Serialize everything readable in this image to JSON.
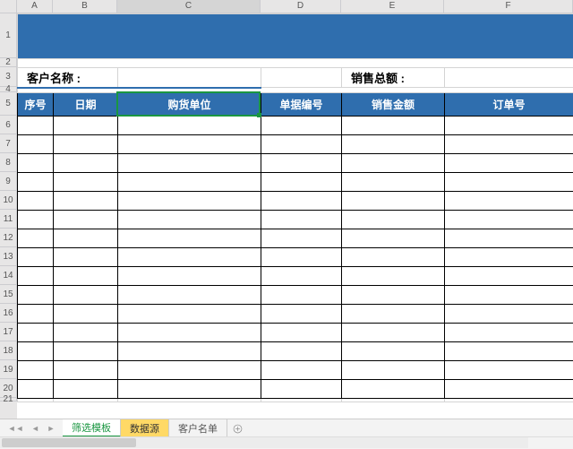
{
  "columns": {
    "A": {
      "label": "A",
      "width": 40
    },
    "B": {
      "label": "B",
      "width": 72
    },
    "C": {
      "label": "C",
      "width": 160
    },
    "D": {
      "label": "D",
      "width": 90
    },
    "E": {
      "label": "E",
      "width": 115
    },
    "F": {
      "label": "F",
      "width": 144
    }
  },
  "rows": {
    "1": 50,
    "2": 10,
    "3": 22,
    "4": 6,
    "5": 26,
    "6": 21,
    "7": 21,
    "8": 21,
    "9": 21,
    "10": 21,
    "11": 21,
    "12": 21,
    "13": 21,
    "14": 21,
    "15": 21,
    "16": 21,
    "17": 21,
    "18": 21,
    "19": 21,
    "20": 21,
    "21": 4
  },
  "active_cell": "C5",
  "labels": {
    "customer_name": "客户名称 :",
    "sales_total": "销售总额 :"
  },
  "chart_data": {
    "type": "table",
    "headers": [
      "序号",
      "日期",
      "购货单位",
      "单据编号",
      "销售金额",
      "订单号"
    ],
    "rows": [
      [
        "",
        "",
        "",
        "",
        "",
        ""
      ],
      [
        "",
        "",
        "",
        "",
        "",
        ""
      ],
      [
        "",
        "",
        "",
        "",
        "",
        ""
      ],
      [
        "",
        "",
        "",
        "",
        "",
        ""
      ],
      [
        "",
        "",
        "",
        "",
        "",
        ""
      ],
      [
        "",
        "",
        "",
        "",
        "",
        ""
      ],
      [
        "",
        "",
        "",
        "",
        "",
        ""
      ],
      [
        "",
        "",
        "",
        "",
        "",
        ""
      ],
      [
        "",
        "",
        "",
        "",
        "",
        ""
      ],
      [
        "",
        "",
        "",
        "",
        "",
        ""
      ],
      [
        "",
        "",
        "",
        "",
        "",
        ""
      ],
      [
        "",
        "",
        "",
        "",
        "",
        ""
      ],
      [
        "",
        "",
        "",
        "",
        "",
        ""
      ],
      [
        "",
        "",
        "",
        "",
        "",
        ""
      ],
      [
        "",
        "",
        "",
        "",
        "",
        ""
      ]
    ]
  },
  "sheet_tabs": [
    {
      "label": "筛选模板",
      "state": "green"
    },
    {
      "label": "数据源",
      "state": "amber"
    },
    {
      "label": "客户名单",
      "state": "normal"
    }
  ],
  "icons": {
    "plus": "plus-circle-icon"
  }
}
